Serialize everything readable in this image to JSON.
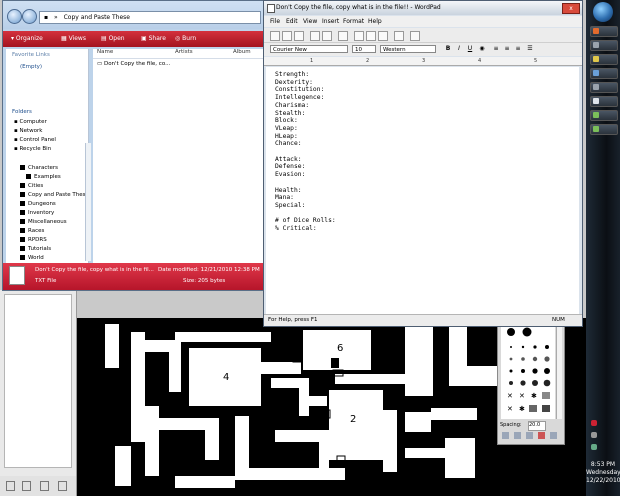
{
  "explorer": {
    "address": "Copy and Paste These",
    "command_bar": [
      "Organize",
      "Views",
      "Open",
      "Share",
      "Burn"
    ],
    "favorite_links_label": "Favorite Links",
    "favorite_links_value": "(Empty)",
    "folders_label": "Folders",
    "nav_items": [
      "Computer",
      "Network",
      "Control Panel",
      "Recycle Bin"
    ],
    "folders": [
      "Characters",
      "Examples",
      "Cities",
      "Copy and Paste These",
      "Dungeons",
      "Inventory",
      "Miscellaneous",
      "Races",
      "RPDRS",
      "Tutorials",
      "World"
    ],
    "columns": [
      "Name",
      "Artists",
      "Album"
    ],
    "file_name": "Don't Copy the file, co...",
    "details": {
      "name": "Don't Copy the file, copy what is in the fil...",
      "type": "TXT File",
      "date_modified": "Date modified: 12/21/2010 12:38 PM",
      "size": "Size: 205 bytes"
    }
  },
  "wordpad": {
    "title": "Don't Copy the file, copy what is in the file!! - WordPad",
    "close_label": "x",
    "menu": [
      "File",
      "Edit",
      "View",
      "Insert",
      "Format",
      "Help"
    ],
    "font": "Courier New",
    "size": "10",
    "script": "Western",
    "format_buttons": [
      "B",
      "I",
      "U"
    ],
    "ruler_marks": [
      "1",
      "2",
      "3",
      "4",
      "5"
    ],
    "lines": [
      "Strength:",
      "Dexterity:",
      "Constitution:",
      "Intellegence:",
      "Charisma:",
      "Stealth:",
      "Block:",
      "VLeap:",
      "HLeap:",
      "Chance:",
      "",
      "Attack:",
      "Defense:",
      "Evasion:",
      "",
      "Health:",
      "Mana:",
      "Special:",
      "",
      "# of Dice Rolls:",
      "% Critical:"
    ],
    "status_left": "For Help, press F1",
    "status_right": "NUM"
  },
  "map": {
    "room_labels": [
      "6",
      "4",
      "2"
    ]
  },
  "brushes": {
    "spacing_label": "Spacing:",
    "spacing_value": "20.0"
  },
  "taskbar": {
    "time": "8:53 PM",
    "day": "Wednesday",
    "date": "12/22/2010"
  },
  "colors": {
    "command_bar": "#b8192a",
    "details_pane": "#c81f32",
    "taskbar": "#0f1419"
  }
}
